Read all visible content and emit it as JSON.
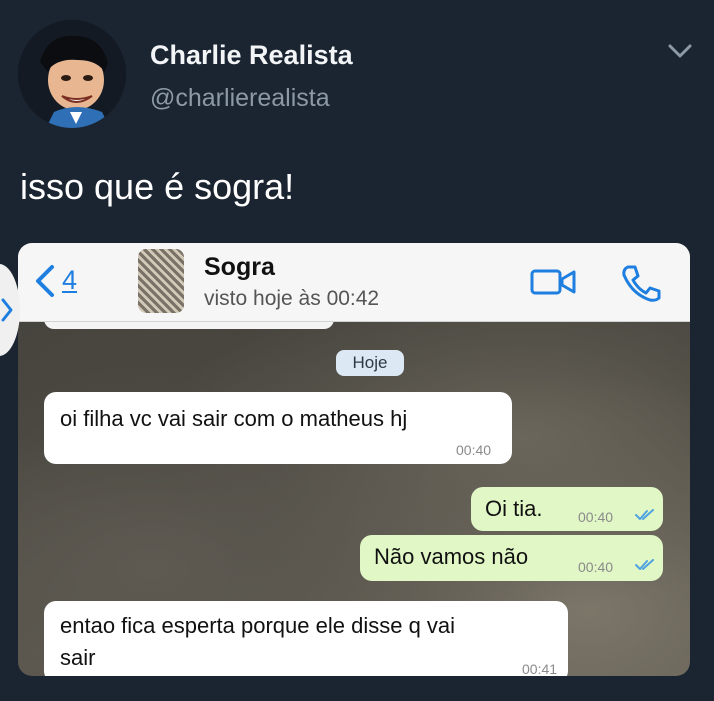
{
  "tweet": {
    "author_name": "Charlie Realista",
    "author_handle": "@charlierealista",
    "text": "isso que é sogra!",
    "icons": {
      "menu": "chevron-down-icon",
      "avatar": "caricature-avatar"
    }
  },
  "chat": {
    "back_count": "4",
    "contact_name": "Sogra",
    "contact_status": "visto hoje às 00:42",
    "date_chip": "Hoje",
    "messages": [
      {
        "direction": "incoming",
        "text": "oi filha vc vai sair com o matheus hj",
        "time": "00:40"
      },
      {
        "direction": "outgoing",
        "text": "Oi tia.",
        "time": "00:40",
        "status": "read"
      },
      {
        "direction": "outgoing",
        "text": "Não vamos não",
        "time": "00:40",
        "status": "read"
      },
      {
        "direction": "incoming",
        "text_line1": "entao fica esperta porque ele disse q vai",
        "text_line2": "sair",
        "time": "00:41"
      }
    ],
    "icons": {
      "back": "chevron-left-icon",
      "video": "video-camera-icon",
      "phone": "phone-icon"
    },
    "colors": {
      "accent": "#1e7fe0",
      "outgoing_bubble": "#e1f7c6",
      "incoming_bubble": "#ffffff",
      "read_ticks": "#4fa3e0"
    }
  },
  "colors": {
    "background": "#1b2431",
    "handle": "#8d99a6"
  }
}
